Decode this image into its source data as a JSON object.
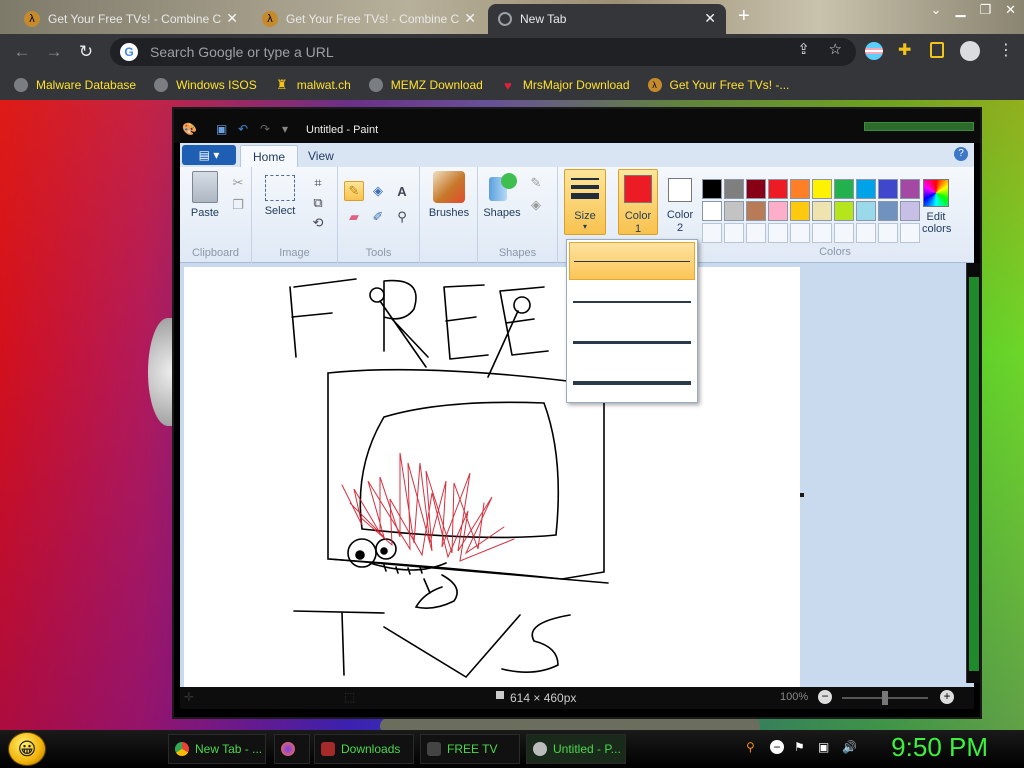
{
  "browser": {
    "tabs": [
      {
        "title": "Get Your Free TVs! - Combine C",
        "active": false
      },
      {
        "title": "Get Your Free TVs! - Combine C",
        "active": false
      },
      {
        "title": "New Tab",
        "active": true
      }
    ],
    "new_tab_label": "+",
    "omnibox": {
      "placeholder": "Search Google or type a URL"
    },
    "bookmarks": [
      "Malware Database",
      "Windows ISOS",
      "malwat.ch",
      "MEMZ Download",
      "MrsMajor Download",
      "Get Your Free TVs! -..."
    ]
  },
  "paint": {
    "title": "Untitled - Paint",
    "file_menu": "▤ ▾",
    "tabs": [
      "Home",
      "View"
    ],
    "help": "?",
    "groups": {
      "clipboard": {
        "label": "Clipboard",
        "paste": "Paste"
      },
      "image": {
        "label": "Image",
        "select": "Select"
      },
      "tools": {
        "label": "Tools"
      },
      "brushes": {
        "label": "Brushes"
      },
      "shapes": {
        "label": "Shapes",
        "button": "Shapes"
      },
      "size": {
        "label": "Size"
      },
      "colors": {
        "label": "Colors",
        "color1": "Color",
        "color1_n": "1",
        "color2": "Color",
        "color2_n": "2",
        "edit": "Edit",
        "edit2": "colors"
      }
    },
    "palette_row1": [
      "#000000",
      "#7f7f7f",
      "#880015",
      "#ed1c24",
      "#ff7f27",
      "#fff200",
      "#22b14c",
      "#00a2e8",
      "#3f48cc",
      "#a349a4"
    ],
    "palette_row2": [
      "#ffffff",
      "#c3c3c3",
      "#b97a57",
      "#ffaec9",
      "#ffc90e",
      "#efe4b0",
      "#b5e61d",
      "#99d9ea",
      "#7092be",
      "#c8bfe7"
    ],
    "color1_value": "#ed1c24",
    "color2_value": "#ffffff",
    "status": {
      "dimensions": "614 × 460px",
      "zoom": "100%"
    }
  },
  "taskbar": {
    "items": [
      "New Tab - ...",
      "Downloads",
      "FREE TV",
      "Untitled - P..."
    ],
    "clock": "9:50 PM"
  }
}
